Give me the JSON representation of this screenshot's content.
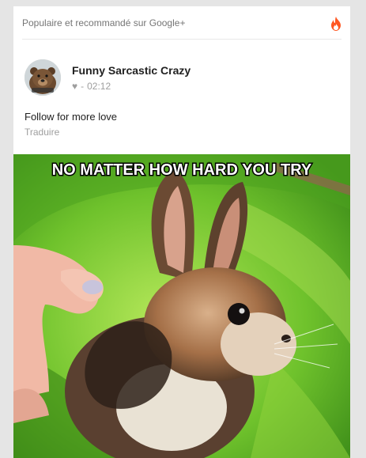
{
  "header": {
    "title": "Populaire et recommandé sur Google+",
    "icon": "flame-icon"
  },
  "post": {
    "author": "Funny Sarcastic Crazy",
    "meta_icon": "heart-icon",
    "separator": "-",
    "time": "02:12",
    "text": "Follow for more love",
    "translate_label": "Traduire",
    "avatar_caption": "funny sarcastic crazy",
    "image": {
      "caption": "NO MATTER HOW HARD YOU TRY",
      "description": "wet brown rabbit in a green tub held by a hand"
    }
  },
  "colors": {
    "accent": "#ff5722",
    "background": "#e5e5e5",
    "card": "#ffffff",
    "tub_green": "#5fb82a"
  }
}
